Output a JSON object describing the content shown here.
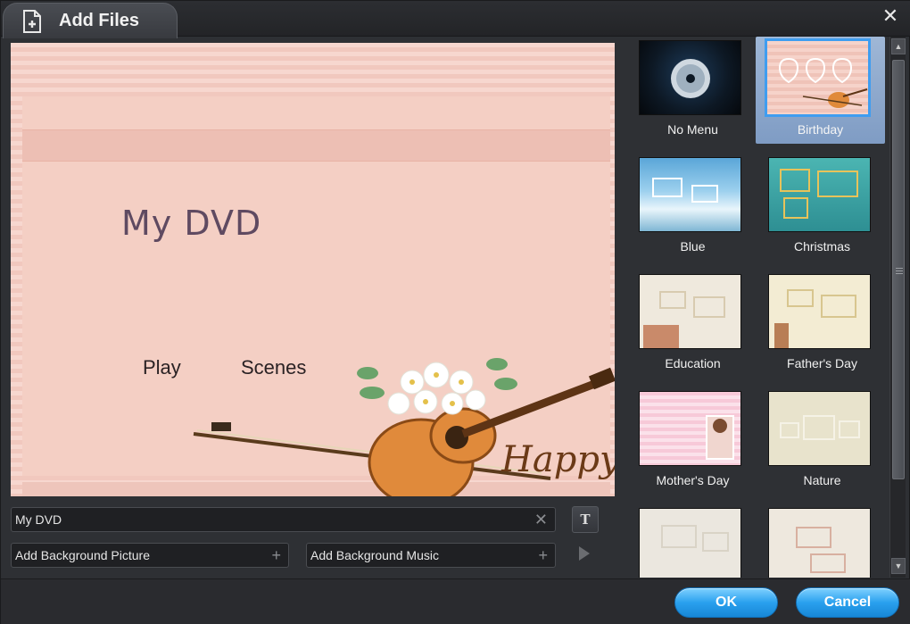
{
  "window": {
    "title": "Add Files",
    "close_glyph": "✕"
  },
  "preview": {
    "menu_title": "My DVD",
    "buttons": [
      "Play",
      "Scenes"
    ],
    "decoration_text": "Happy"
  },
  "controls": {
    "title_input_value": "My DVD",
    "clear_glyph": "✕",
    "text_button": "T",
    "bg_picture_label": "Add Background Picture",
    "bg_music_label": "Add Background Music",
    "plus_glyph": "+"
  },
  "templates": [
    {
      "label": "No Menu",
      "selected": false
    },
    {
      "label": "Birthday",
      "selected": true
    },
    {
      "label": "Blue",
      "selected": false
    },
    {
      "label": "Christmas",
      "selected": false
    },
    {
      "label": "Education",
      "selected": false
    },
    {
      "label": "Father's Day",
      "selected": false
    },
    {
      "label": "Mother's Day",
      "selected": false
    },
    {
      "label": "Nature",
      "selected": false
    },
    {
      "label": "",
      "selected": false
    },
    {
      "label": "",
      "selected": false
    }
  ],
  "footer": {
    "ok_label": "OK",
    "cancel_label": "Cancel"
  },
  "colors": {
    "accent": "#2aa0ee",
    "selection": "#3f9df0",
    "background": "#2e3034"
  }
}
